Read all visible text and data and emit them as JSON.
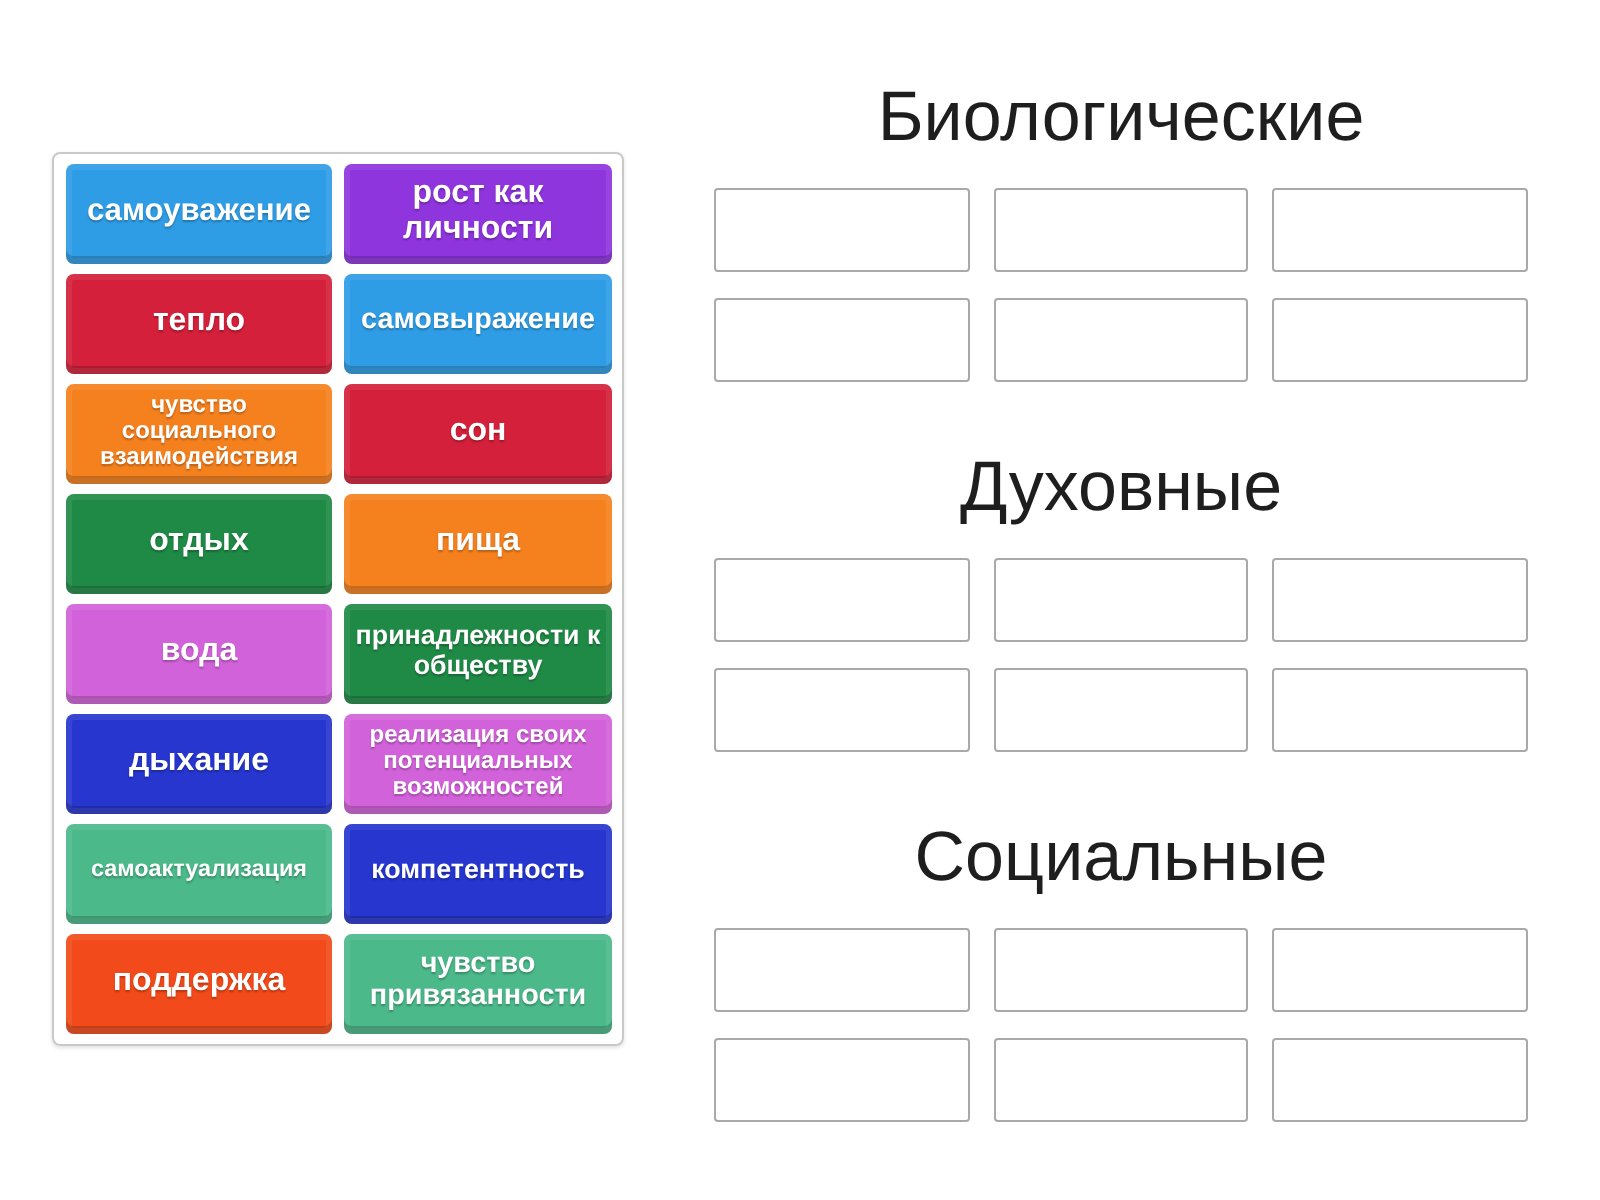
{
  "tiles": [
    {
      "label": "самоуважение",
      "color": "#2f9de5"
    },
    {
      "label": "тепло",
      "color": "#d4203a"
    },
    {
      "label": "чувство социального взаимодействия",
      "color": "#f5801e"
    },
    {
      "label": "отдых",
      "color": "#1f8a45"
    },
    {
      "label": "вода",
      "color": "#d262da"
    },
    {
      "label": "дыхание",
      "color": "#2636cf"
    },
    {
      "label": "самоактуализация",
      "color": "#4bb98a"
    },
    {
      "label": "поддержка",
      "color": "#f24a1a"
    },
    {
      "label": "рост как личности",
      "color": "#8f35de"
    },
    {
      "label": "самовыражение",
      "color": "#2f9de5"
    },
    {
      "label": "сон",
      "color": "#d4203a"
    },
    {
      "label": "пища",
      "color": "#f5801e"
    },
    {
      "label": "принадлежности к обществу",
      "color": "#1f8a45"
    },
    {
      "label": "реализация своих потенциальных возможностей",
      "color": "#d262da"
    },
    {
      "label": "компетентность",
      "color": "#2636cf"
    },
    {
      "label": "чувство привязанности",
      "color": "#4bb98a"
    }
  ],
  "groups": [
    {
      "title": "Биологические",
      "slots": [
        {
          "filled": false
        },
        {
          "filled": false
        },
        {
          "filled": false
        },
        {
          "filled": false
        },
        {
          "filled": false
        },
        {
          "filled": false
        }
      ]
    },
    {
      "title": "Духовные",
      "slots": [
        {
          "filled": false
        },
        {
          "filled": false
        },
        {
          "filled": false
        },
        {
          "filled": false
        },
        {
          "filled": false
        },
        {
          "filled": false
        }
      ]
    },
    {
      "title": "Социальные",
      "slots": [
        {
          "filled": false
        },
        {
          "filled": false
        },
        {
          "filled": false
        },
        {
          "filled": false
        },
        {
          "filled": false
        },
        {
          "filled": false
        }
      ]
    }
  ]
}
